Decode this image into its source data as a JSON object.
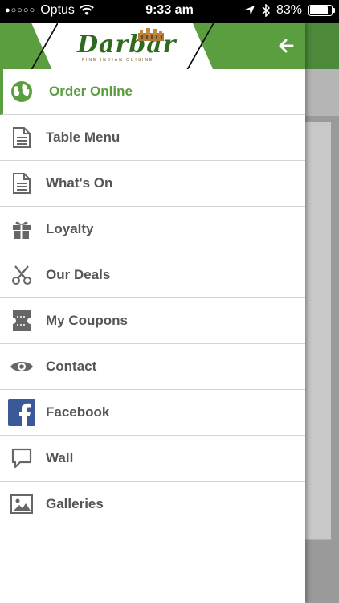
{
  "status_bar": {
    "carrier": "Optus",
    "time": "9:33 am",
    "battery_percent": "83%",
    "battery_level": 0.83
  },
  "header": {
    "logo_text": "Darbar",
    "logo_tagline": "FINE INDIAN CUISINE",
    "back_icon": "arrow-left-icon"
  },
  "menu": {
    "items": [
      {
        "label": "Order Online",
        "icon": "globe-icon",
        "active": true
      },
      {
        "label": "Table Menu",
        "icon": "document-icon"
      },
      {
        "label": "What's On",
        "icon": "document-icon"
      },
      {
        "label": "Loyalty",
        "icon": "gift-icon"
      },
      {
        "label": "Our Deals",
        "icon": "scissors-icon"
      },
      {
        "label": "My Coupons",
        "icon": "ticket-icon"
      },
      {
        "label": "Contact",
        "icon": "eye-icon"
      },
      {
        "label": "Facebook",
        "icon": "facebook-icon"
      },
      {
        "label": "Wall",
        "icon": "chat-bubble-icon"
      },
      {
        "label": "Galleries",
        "icon": "image-icon"
      }
    ]
  },
  "colors": {
    "accent": "#5a9e40",
    "text": "#555555",
    "facebook": "#3b5998"
  }
}
